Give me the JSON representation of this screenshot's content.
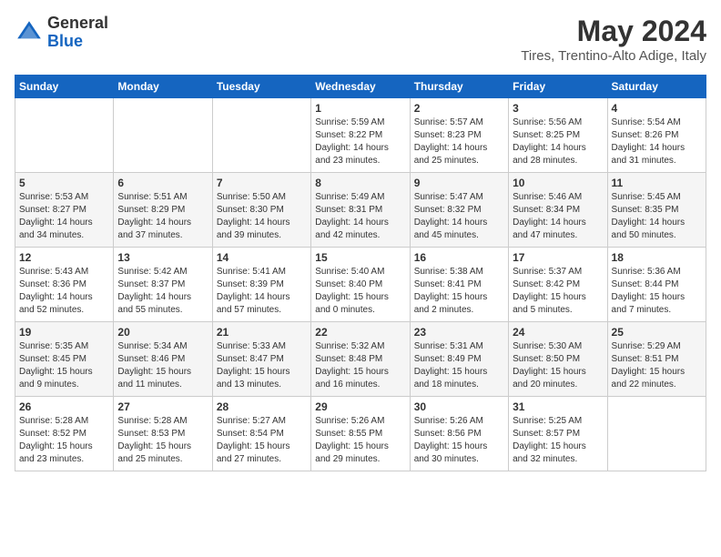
{
  "header": {
    "logo_general": "General",
    "logo_blue": "Blue",
    "month_year": "May 2024",
    "location": "Tires, Trentino-Alto Adige, Italy"
  },
  "days_of_week": [
    "Sunday",
    "Monday",
    "Tuesday",
    "Wednesday",
    "Thursday",
    "Friday",
    "Saturday"
  ],
  "weeks": [
    [
      {
        "day": "",
        "sunrise": "",
        "sunset": "",
        "daylight": ""
      },
      {
        "day": "",
        "sunrise": "",
        "sunset": "",
        "daylight": ""
      },
      {
        "day": "",
        "sunrise": "",
        "sunset": "",
        "daylight": ""
      },
      {
        "day": "1",
        "sunrise": "Sunrise: 5:59 AM",
        "sunset": "Sunset: 8:22 PM",
        "daylight": "Daylight: 14 hours and 23 minutes."
      },
      {
        "day": "2",
        "sunrise": "Sunrise: 5:57 AM",
        "sunset": "Sunset: 8:23 PM",
        "daylight": "Daylight: 14 hours and 25 minutes."
      },
      {
        "day": "3",
        "sunrise": "Sunrise: 5:56 AM",
        "sunset": "Sunset: 8:25 PM",
        "daylight": "Daylight: 14 hours and 28 minutes."
      },
      {
        "day": "4",
        "sunrise": "Sunrise: 5:54 AM",
        "sunset": "Sunset: 8:26 PM",
        "daylight": "Daylight: 14 hours and 31 minutes."
      }
    ],
    [
      {
        "day": "5",
        "sunrise": "Sunrise: 5:53 AM",
        "sunset": "Sunset: 8:27 PM",
        "daylight": "Daylight: 14 hours and 34 minutes."
      },
      {
        "day": "6",
        "sunrise": "Sunrise: 5:51 AM",
        "sunset": "Sunset: 8:29 PM",
        "daylight": "Daylight: 14 hours and 37 minutes."
      },
      {
        "day": "7",
        "sunrise": "Sunrise: 5:50 AM",
        "sunset": "Sunset: 8:30 PM",
        "daylight": "Daylight: 14 hours and 39 minutes."
      },
      {
        "day": "8",
        "sunrise": "Sunrise: 5:49 AM",
        "sunset": "Sunset: 8:31 PM",
        "daylight": "Daylight: 14 hours and 42 minutes."
      },
      {
        "day": "9",
        "sunrise": "Sunrise: 5:47 AM",
        "sunset": "Sunset: 8:32 PM",
        "daylight": "Daylight: 14 hours and 45 minutes."
      },
      {
        "day": "10",
        "sunrise": "Sunrise: 5:46 AM",
        "sunset": "Sunset: 8:34 PM",
        "daylight": "Daylight: 14 hours and 47 minutes."
      },
      {
        "day": "11",
        "sunrise": "Sunrise: 5:45 AM",
        "sunset": "Sunset: 8:35 PM",
        "daylight": "Daylight: 14 hours and 50 minutes."
      }
    ],
    [
      {
        "day": "12",
        "sunrise": "Sunrise: 5:43 AM",
        "sunset": "Sunset: 8:36 PM",
        "daylight": "Daylight: 14 hours and 52 minutes."
      },
      {
        "day": "13",
        "sunrise": "Sunrise: 5:42 AM",
        "sunset": "Sunset: 8:37 PM",
        "daylight": "Daylight: 14 hours and 55 minutes."
      },
      {
        "day": "14",
        "sunrise": "Sunrise: 5:41 AM",
        "sunset": "Sunset: 8:39 PM",
        "daylight": "Daylight: 14 hours and 57 minutes."
      },
      {
        "day": "15",
        "sunrise": "Sunrise: 5:40 AM",
        "sunset": "Sunset: 8:40 PM",
        "daylight": "Daylight: 15 hours and 0 minutes."
      },
      {
        "day": "16",
        "sunrise": "Sunrise: 5:38 AM",
        "sunset": "Sunset: 8:41 PM",
        "daylight": "Daylight: 15 hours and 2 minutes."
      },
      {
        "day": "17",
        "sunrise": "Sunrise: 5:37 AM",
        "sunset": "Sunset: 8:42 PM",
        "daylight": "Daylight: 15 hours and 5 minutes."
      },
      {
        "day": "18",
        "sunrise": "Sunrise: 5:36 AM",
        "sunset": "Sunset: 8:44 PM",
        "daylight": "Daylight: 15 hours and 7 minutes."
      }
    ],
    [
      {
        "day": "19",
        "sunrise": "Sunrise: 5:35 AM",
        "sunset": "Sunset: 8:45 PM",
        "daylight": "Daylight: 15 hours and 9 minutes."
      },
      {
        "day": "20",
        "sunrise": "Sunrise: 5:34 AM",
        "sunset": "Sunset: 8:46 PM",
        "daylight": "Daylight: 15 hours and 11 minutes."
      },
      {
        "day": "21",
        "sunrise": "Sunrise: 5:33 AM",
        "sunset": "Sunset: 8:47 PM",
        "daylight": "Daylight: 15 hours and 13 minutes."
      },
      {
        "day": "22",
        "sunrise": "Sunrise: 5:32 AM",
        "sunset": "Sunset: 8:48 PM",
        "daylight": "Daylight: 15 hours and 16 minutes."
      },
      {
        "day": "23",
        "sunrise": "Sunrise: 5:31 AM",
        "sunset": "Sunset: 8:49 PM",
        "daylight": "Daylight: 15 hours and 18 minutes."
      },
      {
        "day": "24",
        "sunrise": "Sunrise: 5:30 AM",
        "sunset": "Sunset: 8:50 PM",
        "daylight": "Daylight: 15 hours and 20 minutes."
      },
      {
        "day": "25",
        "sunrise": "Sunrise: 5:29 AM",
        "sunset": "Sunset: 8:51 PM",
        "daylight": "Daylight: 15 hours and 22 minutes."
      }
    ],
    [
      {
        "day": "26",
        "sunrise": "Sunrise: 5:28 AM",
        "sunset": "Sunset: 8:52 PM",
        "daylight": "Daylight: 15 hours and 23 minutes."
      },
      {
        "day": "27",
        "sunrise": "Sunrise: 5:28 AM",
        "sunset": "Sunset: 8:53 PM",
        "daylight": "Daylight: 15 hours and 25 minutes."
      },
      {
        "day": "28",
        "sunrise": "Sunrise: 5:27 AM",
        "sunset": "Sunset: 8:54 PM",
        "daylight": "Daylight: 15 hours and 27 minutes."
      },
      {
        "day": "29",
        "sunrise": "Sunrise: 5:26 AM",
        "sunset": "Sunset: 8:55 PM",
        "daylight": "Daylight: 15 hours and 29 minutes."
      },
      {
        "day": "30",
        "sunrise": "Sunrise: 5:26 AM",
        "sunset": "Sunset: 8:56 PM",
        "daylight": "Daylight: 15 hours and 30 minutes."
      },
      {
        "day": "31",
        "sunrise": "Sunrise: 5:25 AM",
        "sunset": "Sunset: 8:57 PM",
        "daylight": "Daylight: 15 hours and 32 minutes."
      },
      {
        "day": "",
        "sunrise": "",
        "sunset": "",
        "daylight": ""
      }
    ]
  ]
}
